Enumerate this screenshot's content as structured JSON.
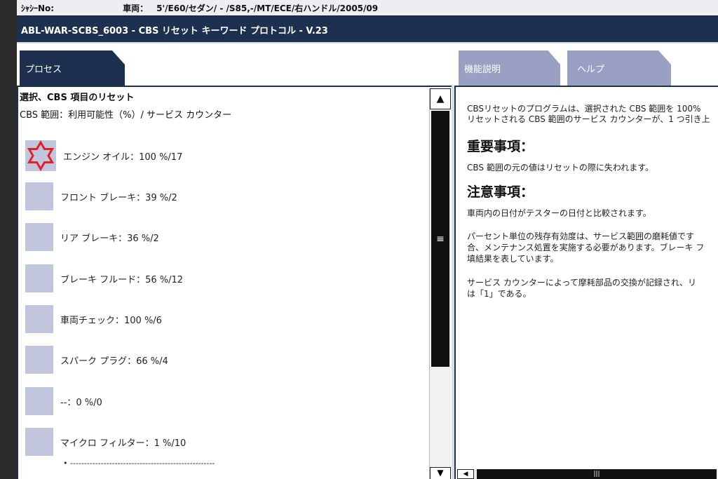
{
  "topbar": {
    "chassis_label": "ｼｬｼｰNo:",
    "vehicle_label": "車両：",
    "vehicle_value": "5'/E60/セダン/ - /S85,-/MT/ECE/右ハンドル/2005/09"
  },
  "title": "ABL-WAR-SCBS_6003 - CBS リセット キーワード プロトコル - V.23",
  "tabs": {
    "process": "プロセス",
    "function": "機能説明",
    "help": "ヘルプ"
  },
  "left": {
    "heading": "選択、CBS 項目のリセット",
    "subheading": "CBS 範囲：利用可能性（%）/ サービス カウンター",
    "items": [
      {
        "label": "エンジン オイル：100 %/17",
        "icon": "red-star-warning-icon"
      },
      {
        "label": "フロント ブレーキ：39 %/2",
        "icon": "status-box"
      },
      {
        "label": "リア ブレーキ：36 %/2",
        "icon": "status-box"
      },
      {
        "label": "ブレーキ フルード：56 %/12",
        "icon": "status-box"
      },
      {
        "label": "車両チェック：100 %/6",
        "icon": "status-box"
      },
      {
        "label": "スパーク プラグ：66 %/4",
        "icon": "status-box"
      },
      {
        "label": "--：0 %/0",
        "icon": "status-box"
      },
      {
        "label": "マイクロ フィルター：1 %/10",
        "icon": "status-box"
      }
    ],
    "dash_line": "• ----------------------------------------------------"
  },
  "right": {
    "intro_line1": "CBSリセットのプログラムは、選択された CBS 範囲を 100%",
    "intro_line2": "リセットされる CBS 範囲のサービス カウンターが、1 つ引き上",
    "important_heading": "重要事項：",
    "important_text": "CBS 範囲の元の値はリセットの際に失われます。",
    "caution_heading": "注意事項：",
    "caution_text": "車両内の日付がテスターの日付と比較されます。",
    "para_line1": "パーセント単位の残存有効度は、サービス範囲の磨耗値です",
    "para_line2": "合、メンテナンス処置を実施する必要があります。ブレーキ フ",
    "para_line3": "填結果を表しています。",
    "counter_line1": "サービス カウンターによって摩耗部品の交換が記録され、リ",
    "counter_line2": "は「1」である。"
  },
  "colors": {
    "accent_dark": "#1e3050",
    "tab_inactive": "#9a9fc4",
    "status_box": "#c2c6dc",
    "warning_star": "#e0202a"
  }
}
